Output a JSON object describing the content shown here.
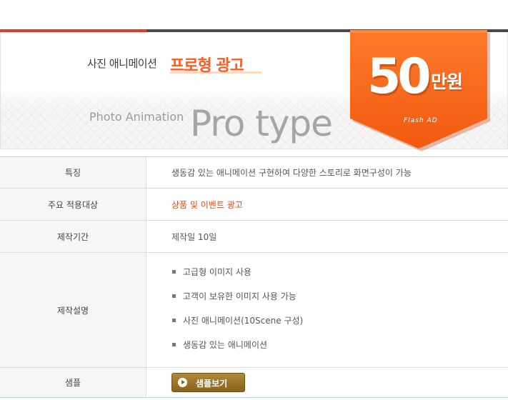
{
  "header": {
    "title_ko": "사진 애니메이션",
    "title_highlight": "프로형 광고",
    "subtitle_en": "Photo Animation",
    "subtitle_big": "Pro type"
  },
  "price_badge": {
    "amount": "50",
    "unit": "만원",
    "subtext": "Flash AD",
    "color": "#ff6a1f"
  },
  "details": {
    "features_label": "특징",
    "features_value": "생동감 있는 애니메이션 구현하여 다양한 스토리로  화면구성이 가능",
    "target_label": "주요 적용대상",
    "target_value": "상품 및 이벤트  광고",
    "period_label": "제작기간",
    "period_value": "제작일 10일",
    "description_label": "제작설명",
    "description_items": [
      "고급형 이미지 사용",
      "고객이 보유한 이미지 사용 가능",
      "사진 애니메이션(10Scene 구성)",
      "생동감 있는 애니메이션"
    ],
    "sample_label": "샘플",
    "sample_button": "샘플보기"
  },
  "colors": {
    "accent_red": "#e03a2a",
    "highlight_orange": "#e24a1a",
    "button_brown": "#8b6a25"
  },
  "icons": {
    "sample_button_icon": "play-icon"
  }
}
